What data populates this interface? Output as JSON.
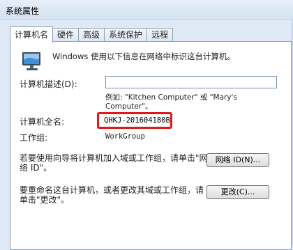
{
  "window": {
    "title": "系统属性"
  },
  "tabs": [
    {
      "label": "计算机名",
      "active": true
    },
    {
      "label": "硬件"
    },
    {
      "label": "高级"
    },
    {
      "label": "系统保护"
    },
    {
      "label": "远程"
    }
  ],
  "computer_name_tab": {
    "intro": "Windows 使用以下信息在网络中标识这台计算机。",
    "description_label": "计算机描述(D):",
    "description_value": "",
    "hint": "例如: \"Kitchen Computer\" 或 \"Mary's Computer\"。",
    "fullname_label": "计算机全名:",
    "fullname_value": "QHKJ-201604180B",
    "workgroup_label": "工作组:",
    "workgroup_value": "WorkGroup",
    "network_id_text": "若要使用向导将计算机加入域或工作组，请单击\"网络 ID\"。",
    "network_id_button": "网络 ID(N)...",
    "change_text": "要重命名这台计算机，或者更改其域或工作组，请单击\"更改\"。",
    "change_button": "更改(C)...",
    "highlight_color": "#e01818"
  }
}
